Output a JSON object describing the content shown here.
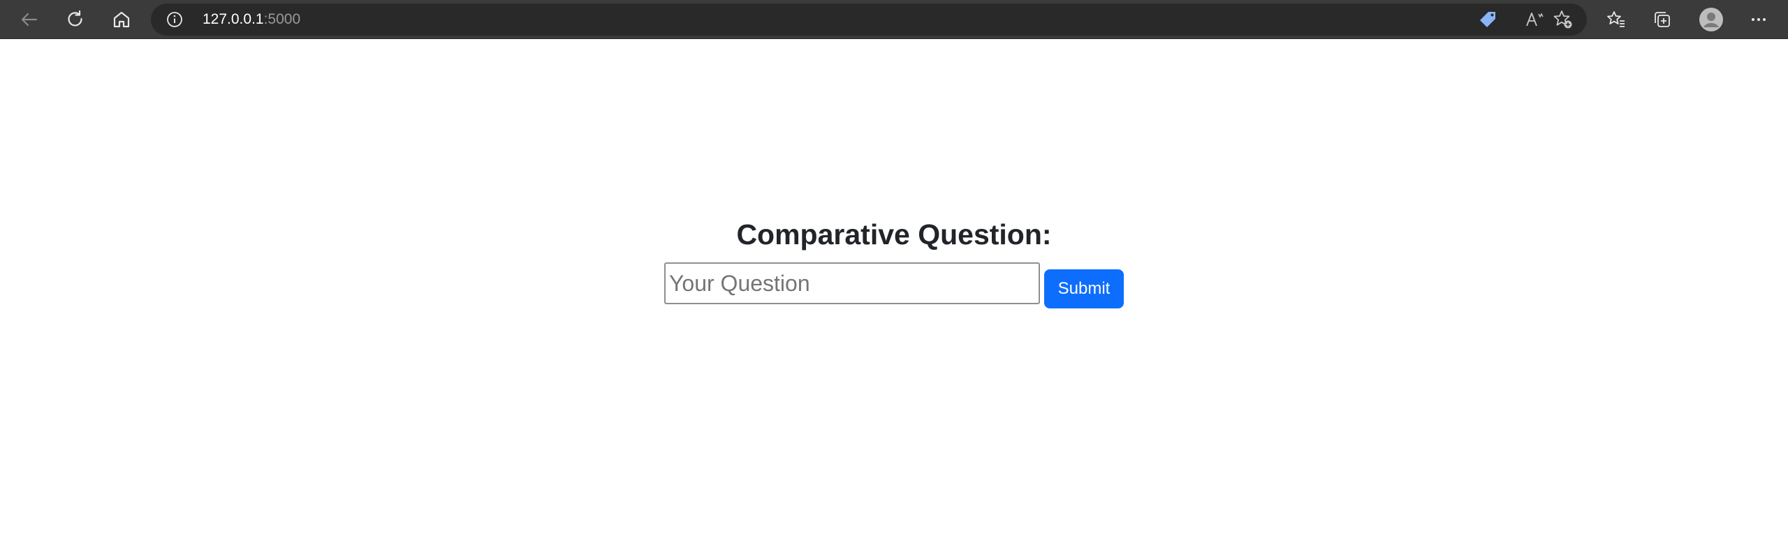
{
  "browser": {
    "address": {
      "host": "127.0.0.1",
      "port": ":5000"
    },
    "icons": {
      "back": "back-arrow-icon",
      "refresh": "refresh-icon",
      "home": "home-icon",
      "site_info": "info-icon",
      "shopping": "price-tag-icon",
      "read_aloud": "read-aloud-icon",
      "add_favorite": "add-favorite-icon",
      "favorites": "favorites-icon",
      "collections": "collections-icon",
      "profile": "profile-avatar-icon",
      "more": "more-options-icon"
    },
    "colors": {
      "toolbar_bg": "#3b3b3b",
      "address_bg": "#292929",
      "tag_blue": "#8ab4f8"
    }
  },
  "page": {
    "title": "Comparative Question:",
    "form": {
      "input_value": "",
      "input_placeholder": "Your Question",
      "submit_label": "Submit"
    },
    "colors": {
      "title_text": "#212529",
      "submit_bg": "#0d6efd",
      "submit_text": "#ffffff"
    }
  }
}
